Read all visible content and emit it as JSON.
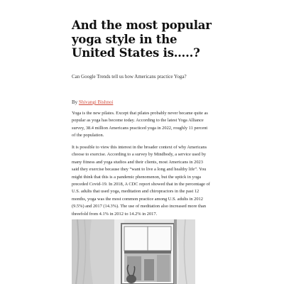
{
  "article": {
    "title": "And the most popular yoga style in the United States is…..?",
    "subtitle": "Can Google Trends tell us how Americans practice Yoga?",
    "byline_prefix": "By ",
    "author": "Shivangi Bishnoi",
    "paragraphs": [
      "Yoga is the new pilates. Except that pilates probably never became quite as popular as yoga has become today. According to the latest Yoga Alliance survey, 38.4 million Americans practiced yoga in 2022, roughly 11 percent of the population.",
      "It is possible to view this interest in the broader context of why Americans choose to exercise. According to a survey by Mindbody, a service used by many fitness and yoga studios and their clients, most Americans in 2023 said they exercise because they “want to live a long and healthy life”. You might think that this is a pandemic phenomenon, but the uptick in yoga preceded Covid-19. In 2018, A CDC report showed that in the percentage of U.S. adults that used yoga, meditation and chiropractors in the past 12 months, yoga was the most common practice among U.S. adults in 2012 (9.5%) and 2017 (14.3%). The use of meditation also increased more than threefold from 4.1% in 2012 to 14.2% in 2017."
    ]
  },
  "colors": {
    "link": "#d04a3a",
    "text": "#222222"
  }
}
